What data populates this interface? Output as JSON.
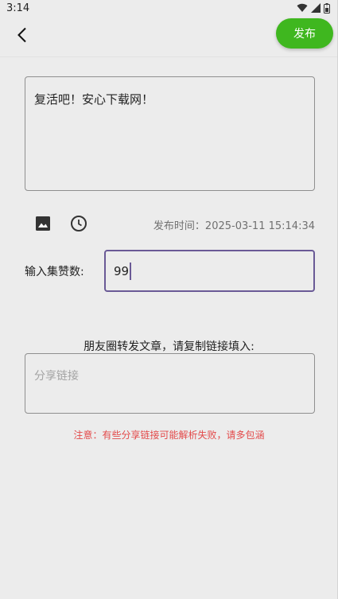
{
  "status_bar": {
    "time": "3:14",
    "icons": [
      "wifi-icon",
      "signal-icon",
      "battery-icon"
    ]
  },
  "app_bar": {
    "back_icon": "back-arrow-icon",
    "publish_label": "发布",
    "accent_color": "#3fb71f"
  },
  "content": {
    "text": "复活吧！安心下载网！"
  },
  "tools": {
    "icons": [
      "image-icon",
      "clock-icon"
    ],
    "publish_time_label": "发布时间：",
    "publish_time_value": "2025-03-11 15:14:34"
  },
  "likes": {
    "label": "输入集赞数:",
    "value": "99"
  },
  "share": {
    "title": "朋友圈转发文章，请复制链接填入:",
    "placeholder": "分享链接"
  },
  "notice": {
    "text": "注意：有些分享链接可能解析失败，请多包涵",
    "color": "#e34a4a"
  }
}
